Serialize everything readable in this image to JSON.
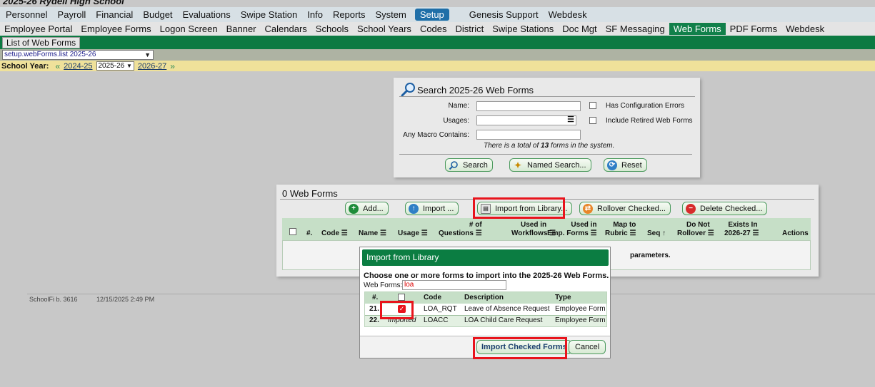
{
  "app": {
    "school_name": "2025-26 Rydell High School"
  },
  "menu_primary": [
    {
      "label": "Personnel"
    },
    {
      "label": "Payroll"
    },
    {
      "label": "Financial"
    },
    {
      "label": "Budget"
    },
    {
      "label": "Evaluations"
    },
    {
      "label": "Swipe Station"
    },
    {
      "label": "Info"
    },
    {
      "label": "Reports"
    },
    {
      "label": "System"
    },
    {
      "label": "Setup"
    },
    {
      "label": "Genesis Support"
    },
    {
      "label": "Webdesk"
    }
  ],
  "menu_secondary": [
    {
      "label": "Employee Portal"
    },
    {
      "label": "Employee Forms"
    },
    {
      "label": "Logon Screen"
    },
    {
      "label": "Banner"
    },
    {
      "label": "Calendars"
    },
    {
      "label": "Schools"
    },
    {
      "label": "School Years"
    },
    {
      "label": "Codes"
    },
    {
      "label": "District"
    },
    {
      "label": "Swipe Stations"
    },
    {
      "label": "Doc Mgt"
    },
    {
      "label": "SF Messaging"
    },
    {
      "label": "Web Forms"
    },
    {
      "label": "PDF Forms"
    },
    {
      "label": "Webdesk"
    }
  ],
  "page_tab": "List of Web Forms",
  "page_select": "setup.webForms.list 2025-26",
  "school_year": {
    "label": "School Year:",
    "prev": "2024-25",
    "current": "2025-26",
    "next": "2026-27"
  },
  "search": {
    "title": "Search 2025-26 Web Forms",
    "name_label": "Name:",
    "usages_label": "Usages:",
    "macro_label": "Any Macro Contains:",
    "config_errors_label": "Has Configuration Errors",
    "retired_label": "Include Retired Web Forms",
    "total_prefix": "There is a total of ",
    "total_count": "13",
    "total_suffix": " forms in the system.",
    "search_button": "Search",
    "named_search_button": "Named Search...",
    "reset_button": "Reset"
  },
  "forms": {
    "title": "0 Web Forms",
    "add_button": "Add...",
    "import_button": "Import ...",
    "import_library_button": "Import from Library...",
    "rollover_button": "Rollover Checked...",
    "delete_button": "Delete Checked...",
    "columns": {
      "num": "#.",
      "code": "Code",
      "name": "Name",
      "usage": "Usage",
      "questions_top": "# of",
      "questions": "Questions",
      "workflows_top": "Used in",
      "workflows": "Workflows",
      "empforms_top": "Used in",
      "empforms": "Emp. Forms",
      "rubric_top": "Map to",
      "rubric": "Rubric",
      "seq": "Seq",
      "rollover_top": "Do Not",
      "rollover": "Rollover",
      "exists_top": "Exists In",
      "exists": "2026-27",
      "actions": "Actions"
    },
    "empty_message": "parameters."
  },
  "footer": {
    "build": "SchoolFi b. 3616",
    "timestamp": "12/15/2025 2:49 PM"
  },
  "dialog": {
    "title": "Import from Library",
    "instruction": "Choose one or more forms to import into the 2025-26 Web Forms.",
    "filter_label": "Web Forms:",
    "filter_value": "loa",
    "columns": {
      "num": "#.",
      "code": "Code",
      "description": "Description",
      "type": "Type"
    },
    "rows": [
      {
        "num": "21.",
        "status": "checked",
        "code": "LOA_RQT",
        "description": "Leave of Absence Request",
        "type": "Employee Form"
      },
      {
        "num": "22.",
        "status": "Imported",
        "code": "LOACC",
        "description": "LOA Child Care Request",
        "type": "Employee Form"
      }
    ],
    "import_button": "Import Checked Forms",
    "cancel_button": "Cancel"
  },
  "colors": {
    "menu_active_blue": "#1f6fa8",
    "setup_green": "#0c7a42",
    "highlight_red": "#e8141c",
    "year_bar": "#efe19a"
  }
}
